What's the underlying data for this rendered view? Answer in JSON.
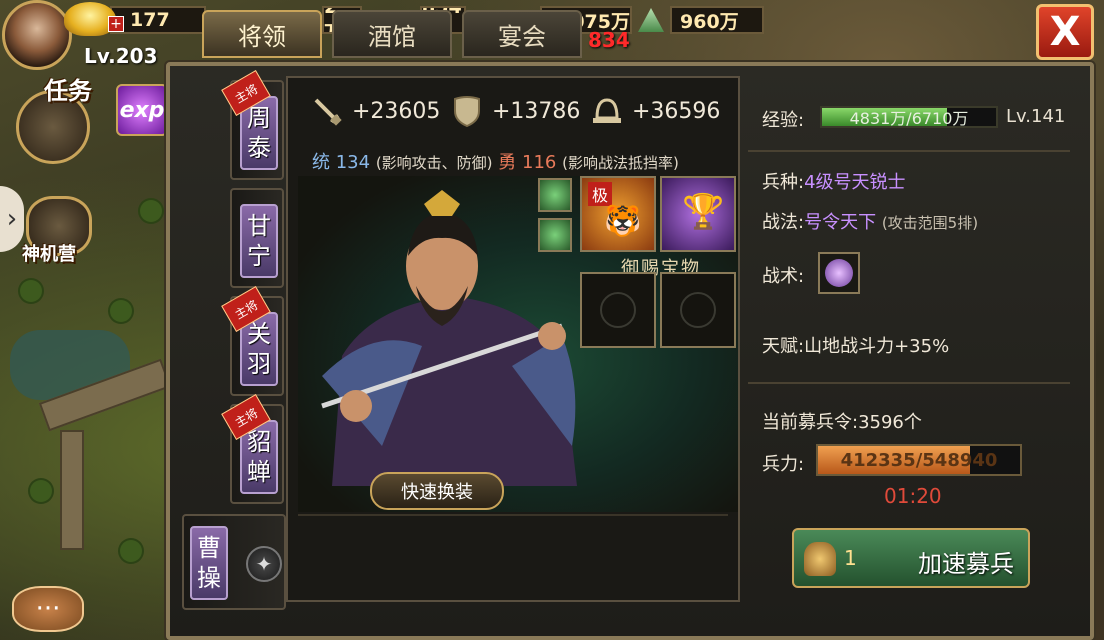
{
  "top": {
    "level": "Lv.203",
    "gold": "177",
    "resource2": "2 万",
    "resource3": "854 万",
    "resource4": "1075万",
    "jade": "960万",
    "red_value": "834",
    "close": "X"
  },
  "tabs": [
    {
      "label": "将领"
    },
    {
      "label": "酒馆"
    },
    {
      "label": "宴会"
    }
  ],
  "left": {
    "task_label": "任务",
    "exp_label": "exp",
    "shenjiying_label": "神机营",
    "arrow": "›",
    "chat": "···"
  },
  "heroes": [
    {
      "name_top": "周",
      "name_bottom": "泰",
      "ribbon": "主将"
    },
    {
      "name_top": "甘",
      "name_bottom": "宁",
      "ribbon": ""
    },
    {
      "name_top": "关",
      "name_bottom": "羽",
      "ribbon": "主将"
    },
    {
      "name_top": "貂",
      "name_bottom": "蝉",
      "ribbon": "主将"
    },
    {
      "name_top": "曹",
      "name_bottom": "操",
      "ribbon": ""
    }
  ],
  "stats": {
    "attack": "+23605",
    "defense": "+13786",
    "hp": "+36596",
    "lead_label": "统",
    "lead_value": "134",
    "lead_note": "(影响攻击、防御)",
    "brave_label": "勇",
    "brave_value": "116",
    "brave_note": "(影响战法抵挡率)"
  },
  "equipment": {
    "treasure_label": "御赐宝物",
    "tiger_tag": "极",
    "quick_change": "快速换装"
  },
  "info": {
    "exp_label": "经验:",
    "exp_value": "4831万/6710万",
    "exp_ratio": 0.72,
    "level": "Lv.141",
    "troop_type_label": "兵种:",
    "troop_type": "4级号天锐士",
    "tactic_label": "战法:",
    "tactic": "号令天下",
    "tactic_range": "(攻击范围5排)",
    "skill_label": "战术:",
    "talent_label": "天赋:",
    "talent": "山地战斗力+35%",
    "recruit_label": "当前募兵令:",
    "recruit_value": "3596个",
    "troops_label": "兵力:",
    "troops_value": "412335/548940",
    "troops_ratio": 0.75,
    "timer": "01:20",
    "speed_count": "1",
    "speed_label": "加速募兵"
  },
  "colors": {
    "accent_gold": "#c9a45a",
    "purple_text": "#c890ff",
    "close_red": "#d0301e",
    "speed_green": "#3a7a48"
  }
}
